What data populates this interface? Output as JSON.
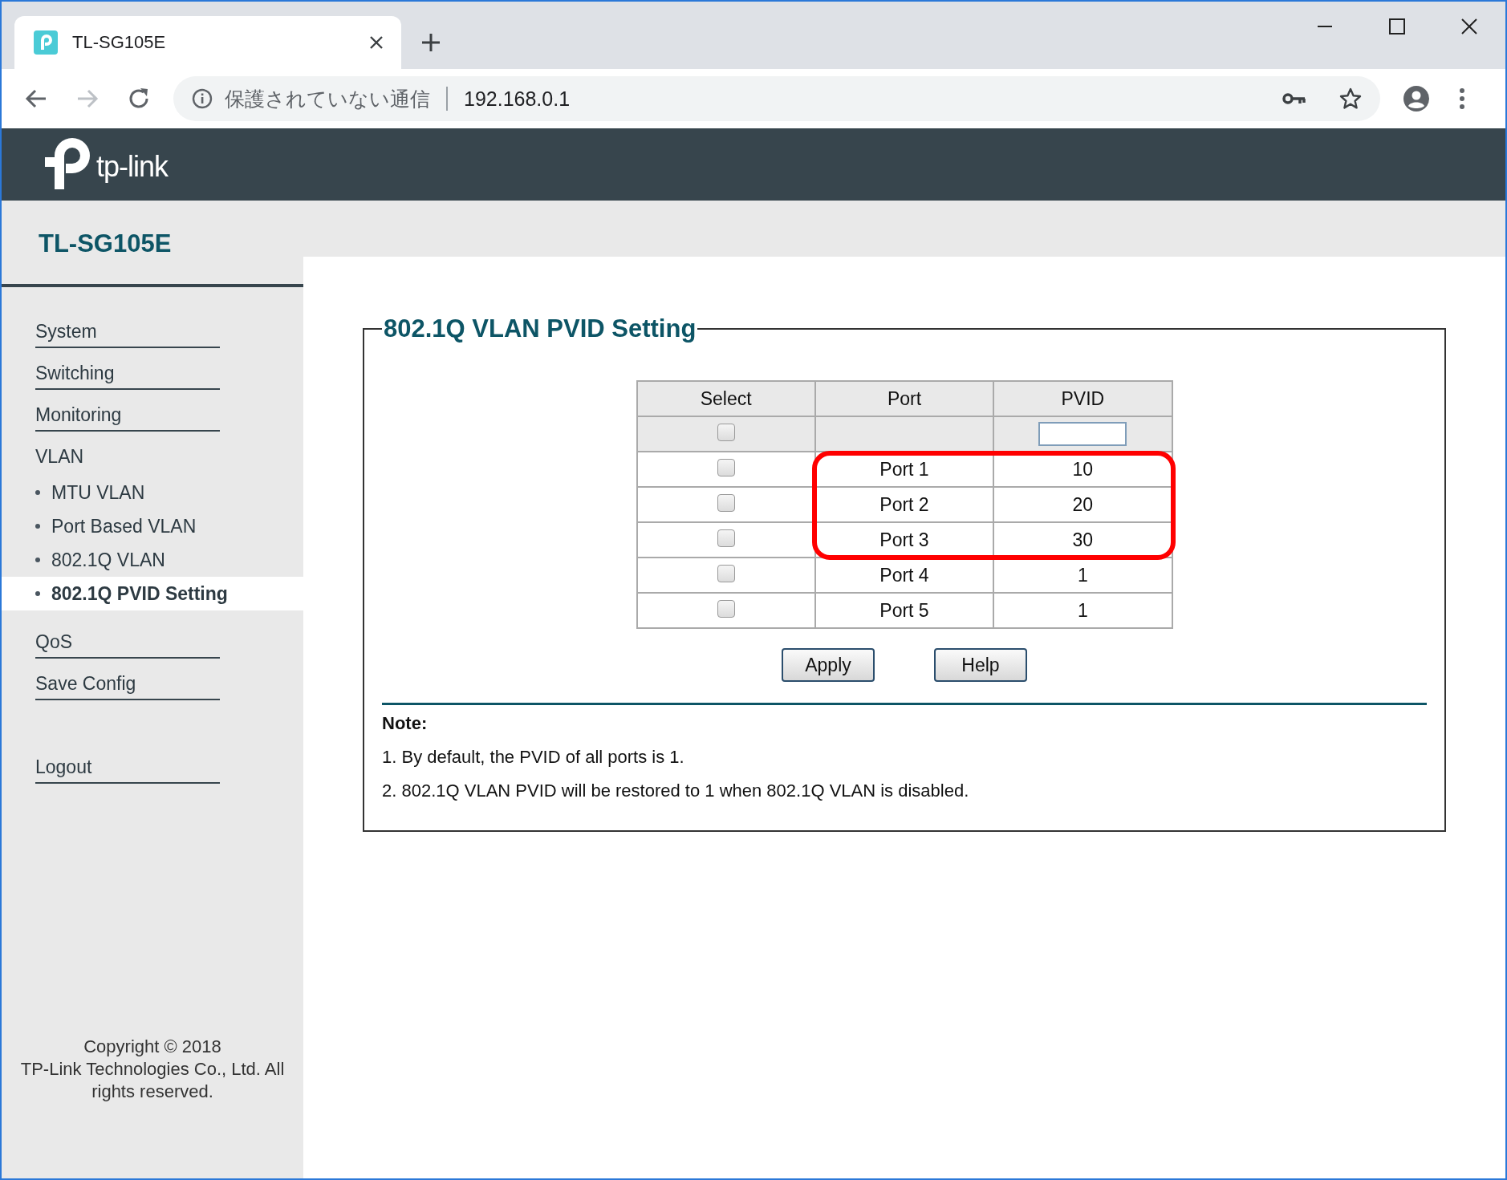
{
  "browser": {
    "tab": {
      "title": "TL-SG105E"
    },
    "forward_button": {
      "disabled": true
    },
    "address_bar": {
      "security_label": "保護されていない通信",
      "url": "192.168.0.1"
    }
  },
  "header": {
    "logo_text": "tp-link"
  },
  "device_title": "TL-SG105E",
  "sidebar": {
    "items": [
      {
        "label": "System",
        "selected": false
      },
      {
        "label": "Switching",
        "selected": false
      },
      {
        "label": "Monitoring",
        "selected": false
      },
      {
        "label": "VLAN",
        "selected": false,
        "children": [
          {
            "label": "MTU VLAN",
            "selected": false
          },
          {
            "label": "Port Based VLAN",
            "selected": false
          },
          {
            "label": "802.1Q VLAN",
            "selected": false
          },
          {
            "label": "802.1Q PVID Setting",
            "selected": true
          }
        ]
      },
      {
        "label": "QoS",
        "selected": false
      },
      {
        "label": "Save Config",
        "selected": false
      },
      {
        "label": "Logout",
        "selected": false
      }
    ],
    "copyright": [
      "Copyright © 2018",
      "TP-Link Technologies Co., Ltd. All rights reserved."
    ]
  },
  "panel": {
    "title": "802.1Q VLAN PVID Setting",
    "columns": [
      "Select",
      "Port",
      "PVID"
    ],
    "select_all": {
      "checked": false
    },
    "rows": [
      {
        "checked": false,
        "port": "Port 1",
        "pvid": "10",
        "highlighted": true
      },
      {
        "checked": false,
        "port": "Port 2",
        "pvid": "20",
        "highlighted": true
      },
      {
        "checked": false,
        "port": "Port 3",
        "pvid": "30",
        "highlighted": true
      },
      {
        "checked": false,
        "port": "Port 4",
        "pvid": "1",
        "highlighted": false
      },
      {
        "checked": false,
        "port": "Port 5",
        "pvid": "1",
        "highlighted": false
      }
    ],
    "buttons": [
      "Apply",
      "Help"
    ],
    "note": {
      "title": "Note:",
      "lines": [
        "1. By default, the PVID of all ports is 1.",
        "2. 802.1Q VLAN PVID will be restored to 1 when 802.1Q VLAN is disabled."
      ]
    }
  }
}
